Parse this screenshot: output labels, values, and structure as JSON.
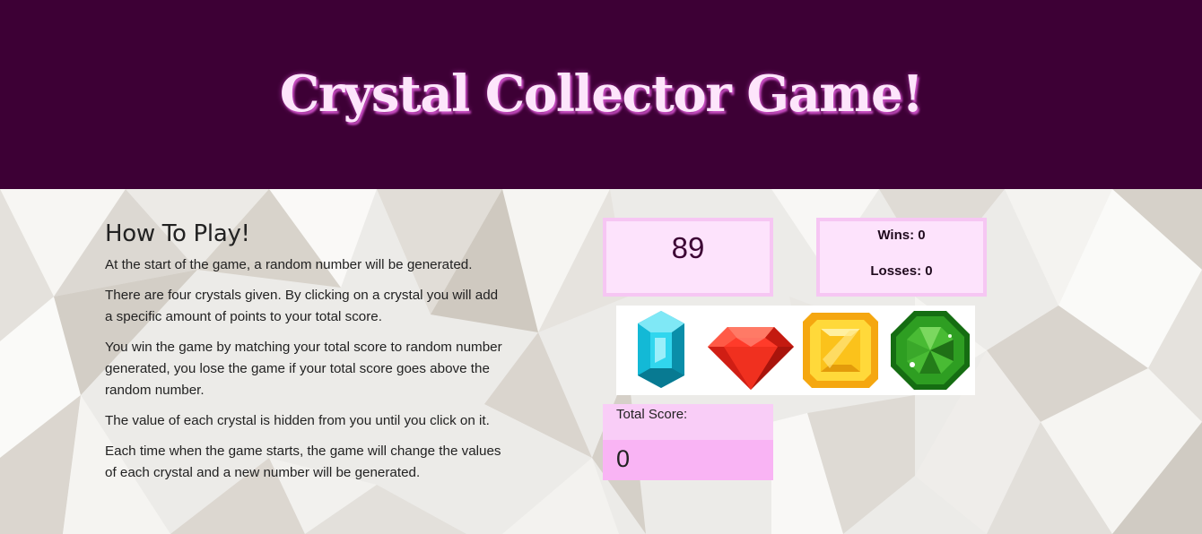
{
  "header": {
    "title": "Crystal Collector Game!"
  },
  "instructions": {
    "heading": "How To Play!",
    "paragraphs": [
      "At the start of the game, a random number will be generated.",
      "There are four crystals given. By clicking on a crystal you will add a specific amount of points to your total score.",
      "You win the game by matching your total score to random number generated, you lose the game if your total score goes above the random number.",
      "The value of each crystal is hidden from you until you click on it.",
      "Each time when the game starts, the game will change the values of each crystal and a new number will be generated."
    ]
  },
  "game": {
    "target_number": "89",
    "wins_text": "Wins: 0",
    "losses_text": "Losses: 0",
    "total_score_label": "Total Score:",
    "total_score_value": "0",
    "crystals": [
      {
        "icon": "blue-crystal-icon",
        "color": "#19c6e0"
      },
      {
        "icon": "red-crystal-icon",
        "color": "#f02a1a"
      },
      {
        "icon": "yellow-crystal-icon",
        "color": "#fbc21b"
      },
      {
        "icon": "green-crystal-icon",
        "color": "#2e9e22"
      }
    ]
  },
  "colors": {
    "header_bg": "#3d0035",
    "title_text": "#fde5fb",
    "box_bg": "#fde3fc",
    "box_border": "#f6c6f3",
    "score_head_bg": "#f9cdf7",
    "score_val_bg": "#f9b4f4"
  }
}
